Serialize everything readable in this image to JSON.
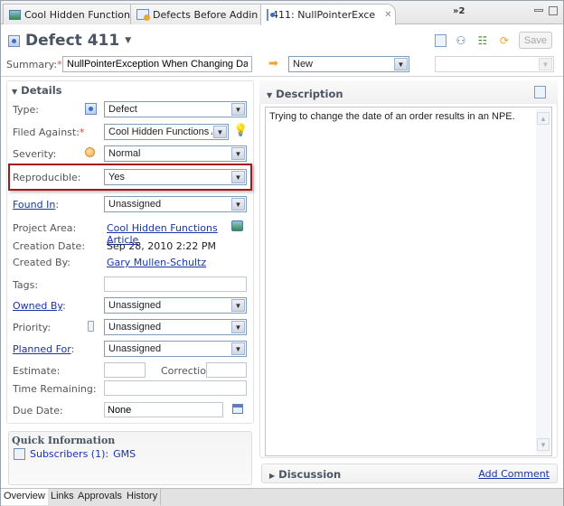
{
  "tabs": [
    {
      "label": "Cool Hidden Function",
      "icon": "project-icon",
      "closable": true,
      "active": false
    },
    {
      "label": "Defects Before Addin",
      "icon": "query-icon",
      "closable": false,
      "active": false
    },
    {
      "label": "411: NullPointerExce",
      "icon": "work-item-icon",
      "closable": true,
      "active": true
    }
  ],
  "tab_overflow": "»2",
  "header": {
    "title": "Defect 411",
    "save_label": "Save",
    "toolbar_icons": [
      "find-related-icon",
      "subscribe-icon",
      "edit-icon",
      "refresh-icon"
    ]
  },
  "summary": {
    "label": "Summary:",
    "required_mark": "*",
    "value": "NullPointerException When Changing Dates",
    "state": "New",
    "resolution": ""
  },
  "details": {
    "title": "Details",
    "fields": {
      "type": {
        "label": "Type:",
        "value": "Defect"
      },
      "filed_against": {
        "label": "Filed Against:",
        "value": "Cool Hidden Functions Ar"
      },
      "severity": {
        "label": "Severity:",
        "value": "Normal"
      },
      "reproducible": {
        "label": "Reproducible:",
        "value": "Yes"
      },
      "found_in": {
        "label": "Found In",
        "value": "Unassigned"
      },
      "project_area": {
        "label": "Project Area:",
        "value": "Cool Hidden Functions Article"
      },
      "creation_date": {
        "label": "Creation Date:",
        "value": "Sep 28, 2010 2:22 PM"
      },
      "created_by": {
        "label": "Created By:",
        "value": "Gary Mullen-Schultz"
      },
      "tags": {
        "label": "Tags:",
        "value": ""
      },
      "owned_by": {
        "label": "Owned By",
        "value": "Unassigned"
      },
      "priority": {
        "label": "Priority:",
        "value": "Unassigned"
      },
      "planned_for": {
        "label": "Planned For",
        "value": "Unassigned"
      },
      "estimate": {
        "label": "Estimate:",
        "value": ""
      },
      "correction": {
        "label": "Correction:",
        "value": ""
      },
      "time_remaining": {
        "label": "Time Remaining:",
        "value": ""
      },
      "due_date": {
        "label": "Due Date:",
        "value": "None"
      }
    }
  },
  "quick_info": {
    "title": "Quick Information",
    "subscribers": "Subscribers (1):",
    "subscriber_names": "GMS"
  },
  "description": {
    "title": "Description",
    "text": "Trying to change the date of an order results in an NPE."
  },
  "discussion": {
    "title": "Discussion",
    "add_comment": "Add Comment"
  },
  "bottom_tabs": [
    {
      "label": "Overview",
      "active": true
    },
    {
      "label": "Links",
      "active": false
    },
    {
      "label": "Approvals",
      "active": false
    },
    {
      "label": "History",
      "active": false
    }
  ],
  "colors": {
    "highlight_border": "#a5171b",
    "link": "#1a33a8",
    "required": "#e04848",
    "title": "#4a5563"
  }
}
